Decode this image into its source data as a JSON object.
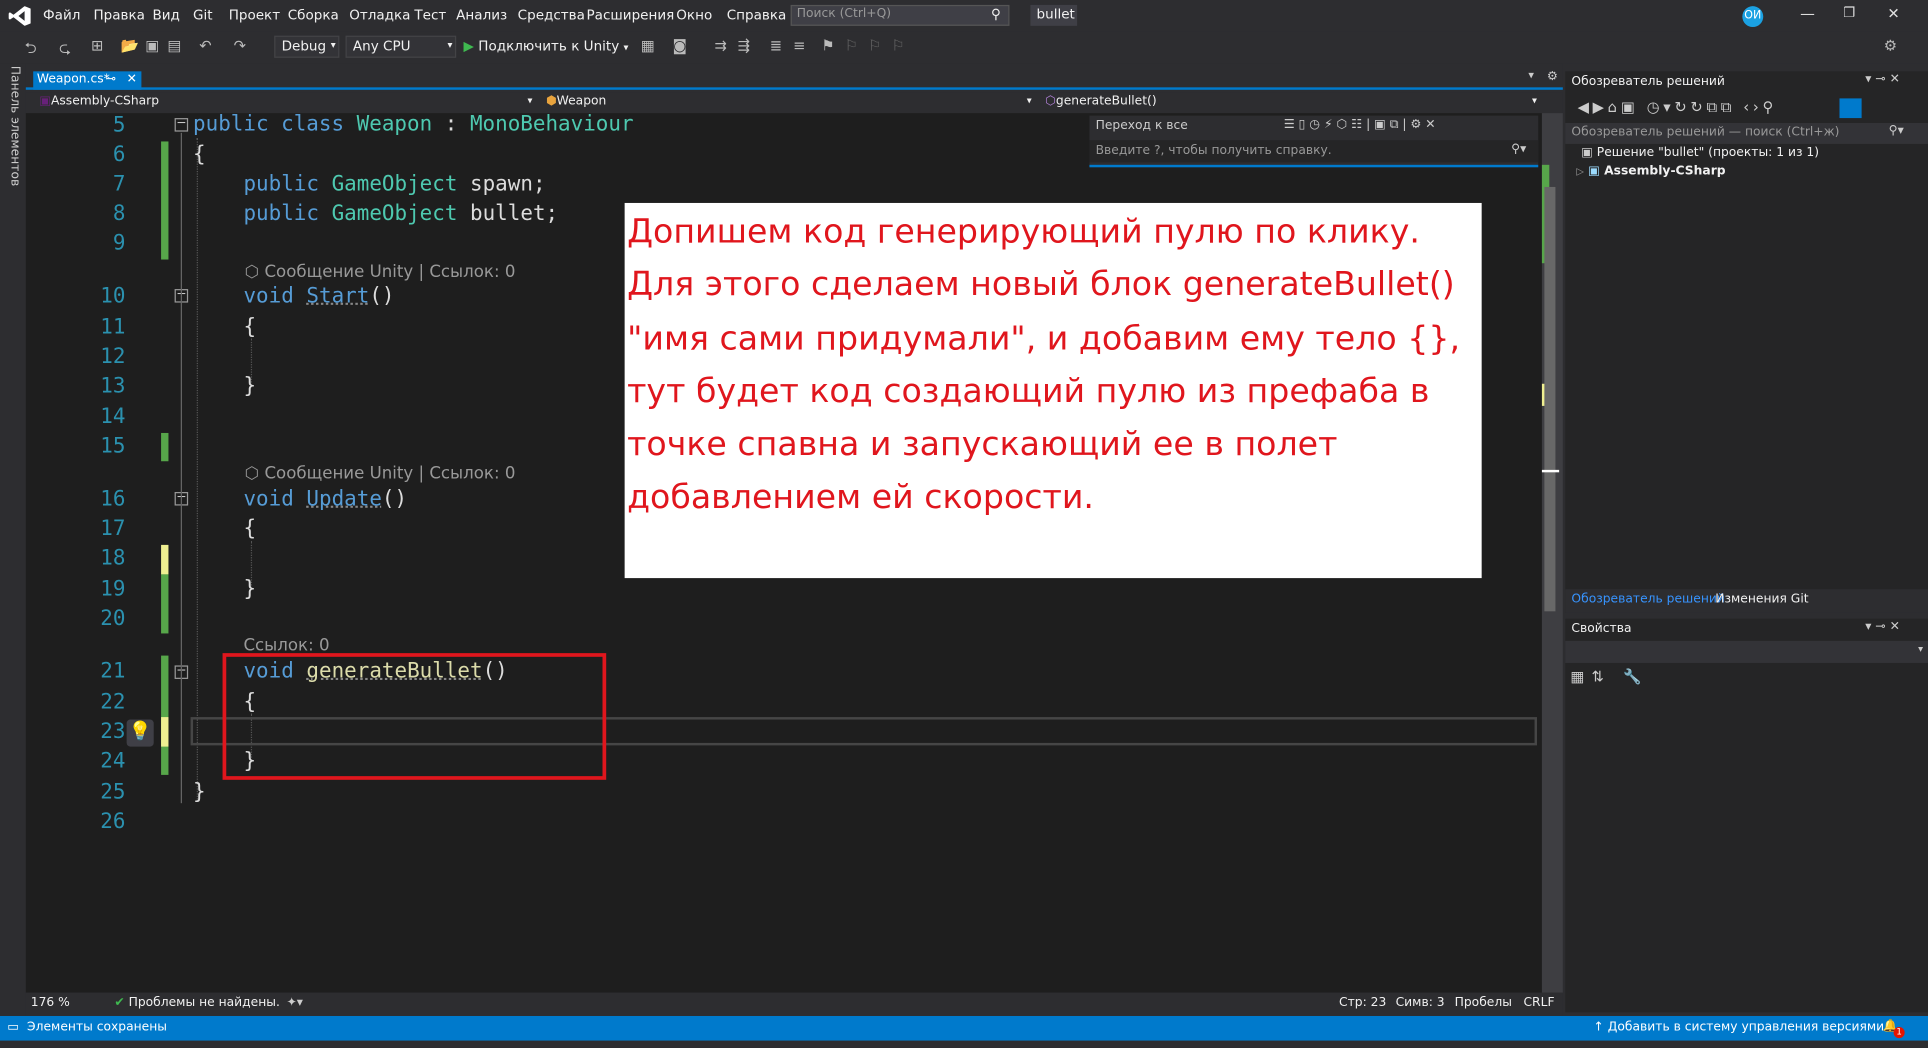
{
  "menu": {
    "items": [
      "Файл",
      "Правка",
      "Вид",
      "Git",
      "Проект",
      "Сборка",
      "Отладка",
      "Тест",
      "Анализ",
      "Средства",
      "Расширения",
      "Окно",
      "Справка"
    ],
    "search_placeholder": "Поиск (Ctrl+Q)",
    "solution_name": "bullet",
    "avatar": "ОИ"
  },
  "toolbar": {
    "config": "Debug",
    "platform": "Any CPU",
    "attach_label": "Подключить к Unity"
  },
  "left_panel_label": "Панель элементов",
  "editor": {
    "tab_label": "Weapon.cs*",
    "nav": {
      "project": "Assembly-CSharp",
      "class": "Weapon",
      "member": "generateBullet()"
    },
    "find": {
      "title": "Переход к все",
      "placeholder": "Введите ?, чтобы получить справку."
    },
    "lens": {
      "start": "⬡ Сообщение Unity | Ссылок: 0",
      "update": "⬡ Сообщение Unity | Ссылок: 0",
      "gen": "Ссылок: 0"
    },
    "lines": {
      "l5": "5",
      "l6": "6",
      "l7": "7",
      "l8": "8",
      "l9": "9",
      "l10": "10",
      "l11": "11",
      "l12": "12",
      "l13": "13",
      "l14": "14",
      "l15": "15",
      "l16": "16",
      "l17": "17",
      "l18": "18",
      "l19": "19",
      "l20": "20",
      "l21": "21",
      "l22": "22",
      "l23": "23",
      "l24": "24",
      "l25": "25",
      "l26": "26"
    },
    "code": {
      "c5_kw": "public class ",
      "c5_ty": "Weapon",
      "c5_op": " : ",
      "c5_base": "MonoBehaviour",
      "c6": "{",
      "c7_kw": "public ",
      "c7_ty": "GameObject",
      "c7_id": " spawn;",
      "c8_kw": "public ",
      "c8_ty": "GameObject",
      "c8_id": " bullet;",
      "c10_kw": "void ",
      "c10_fn": "Start",
      "c10_p": "()",
      "c11": "{",
      "c13": "}",
      "c16_kw": "void ",
      "c16_fn": "Update",
      "c16_p": "()",
      "c17": "{",
      "c19": "}",
      "c21_kw": "void ",
      "c21_fn": "generateBullet",
      "c21_p": "()",
      "c22": "{",
      "c24": "}",
      "c25": "}"
    }
  },
  "overlay_text": "Допишем код генерирующий пулю по клику. Для этого сделаем новый блок generateBullet() \"имя сами придумали\", и добавим ему тело {}, тут будет код создающий пулю из префаба в точке спавна и запускающий ее в полет добавлением ей скорости.",
  "solution_explorer": {
    "title": "Обозреватель решений",
    "search_placeholder": "Обозреватель решений — поиск (Ctrl+ж)",
    "solution": "Решение \"bullet\" (проекты: 1 из 1)",
    "project": "Assembly-CSharp",
    "tabs": [
      "Обозреватель решений",
      "Изменения Git"
    ]
  },
  "properties": {
    "title": "Свойства"
  },
  "bottom": {
    "zoom": "176 %",
    "problems": "Проблемы не найдены.",
    "line": "Стр: 23",
    "col": "Симв: 3",
    "spaces": "Пробелы",
    "eol": "CRLF"
  },
  "status": {
    "left": "Элементы сохранены",
    "right": "Добавить в систему управления версиями",
    "badge": "1"
  }
}
